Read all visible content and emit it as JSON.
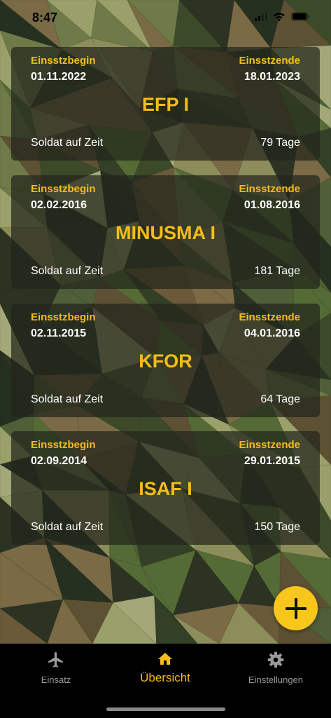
{
  "status_bar": {
    "time": "8:47"
  },
  "cards": [
    {
      "start_label": "Einsstzbegin",
      "start_date": "01.11.2022",
      "end_label": "Einsstzende",
      "end_date": "18.01.2023",
      "mission": "EFP I",
      "status": "Soldat auf Zeit",
      "duration": "79 Tage"
    },
    {
      "start_label": "Einsstzbegin",
      "start_date": "02.02.2016",
      "end_label": "Einsstzende",
      "end_date": "01.08.2016",
      "mission": "MINUSMA I",
      "status": "Soldat auf Zeit",
      "duration": "181 Tage"
    },
    {
      "start_label": "Einsstzbegin",
      "start_date": "02.11.2015",
      "end_label": "Einsstzende",
      "end_date": "04.01.2016",
      "mission": "KFOR",
      "status": "Soldat auf Zeit",
      "duration": "64 Tage"
    },
    {
      "start_label": "Einsstzbegin",
      "start_date": "02.09.2014",
      "end_label": "Einsstzende",
      "end_date": "29.01.2015",
      "mission": "ISAF I",
      "status": "Soldat auf Zeit",
      "duration": "150 Tage"
    }
  ],
  "fab": {
    "icon": "plus-icon"
  },
  "tab_bar": {
    "tabs": [
      {
        "label": "Einsatz",
        "icon": "airplane-icon"
      },
      {
        "label": "Übersicht",
        "icon": "home-icon"
      },
      {
        "label": "Einstellungen",
        "icon": "gear-icon"
      }
    ],
    "active_index": 1
  },
  "colors": {
    "accent": "#f5bd18",
    "fab": "#f9c61b",
    "tab_inactive": "#9a9a9a",
    "card_bg": "#23261c"
  }
}
